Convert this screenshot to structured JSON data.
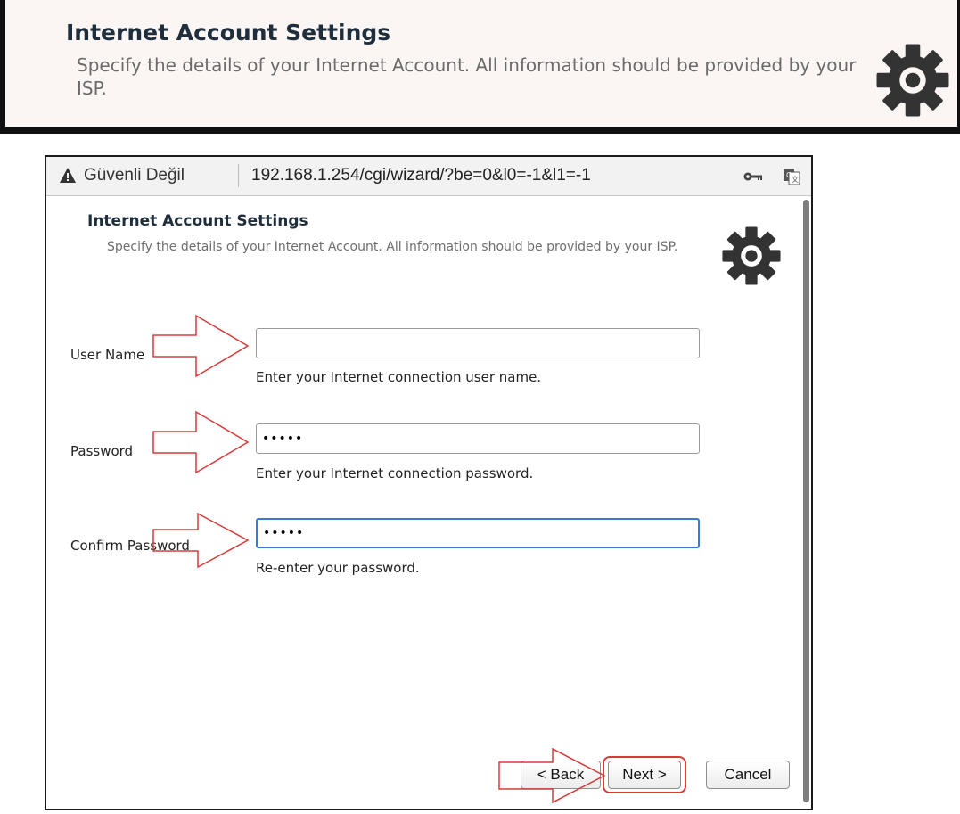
{
  "banner": {
    "title": "Internet Account Settings",
    "description": "Specify the details of your Internet Account. All information should be provided by your ISP.",
    "icon": "gear-icon"
  },
  "browser": {
    "security_label": "Güvenli Değil",
    "url": "192.168.1.254/cgi/wizard/?be=0&l0=-1&l1=-1",
    "icons": [
      "warning-icon",
      "key-icon",
      "translate-icon"
    ]
  },
  "dialog": {
    "title": "Internet Account Settings",
    "description": "Specify the details of your Internet Account. All information should be provided by your ISP.",
    "fields": [
      {
        "label": "User Name",
        "value": "",
        "help": "Enter your Internet connection user name."
      },
      {
        "label": "Password",
        "value": "•••••",
        "help": "Enter your Internet connection password."
      },
      {
        "label": "Confirm Password",
        "value": "•••••",
        "help": "Re-enter your password."
      }
    ],
    "buttons": {
      "back": "< Back",
      "next": "Next >",
      "cancel": "Cancel"
    }
  },
  "annotation_color": "#d83a3a",
  "accent_color": "#3b78d8"
}
